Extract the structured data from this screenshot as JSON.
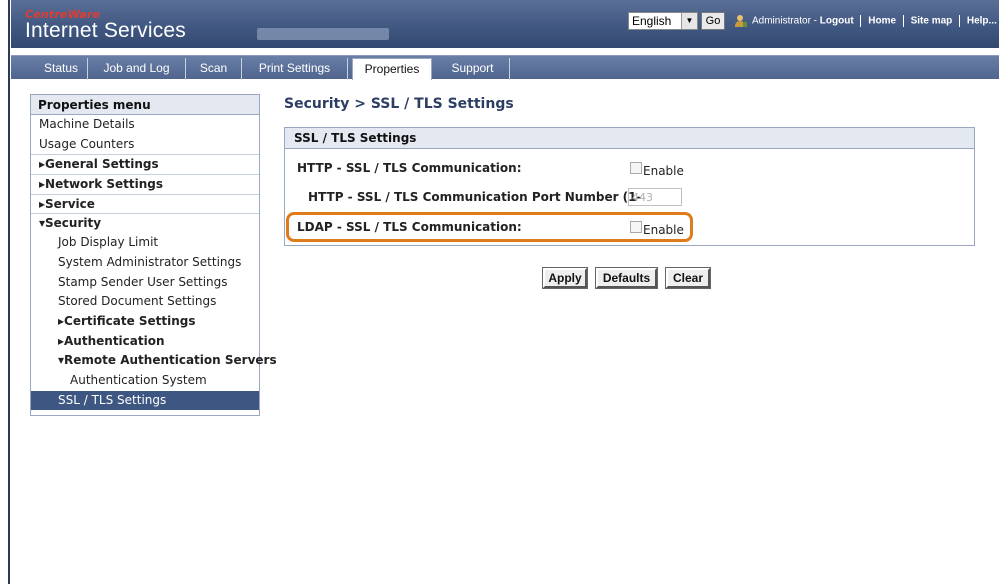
{
  "header": {
    "brand_small": "CentreWare",
    "brand_big": "Internet Services",
    "language": "English",
    "go_label": "Go",
    "user_text": "Administrator - ",
    "logout": "Logout",
    "home": "Home",
    "site_map": "Site map",
    "help": "Help..."
  },
  "nav": {
    "tabs": [
      "Status",
      "Job and Log",
      "Scan",
      "Print Settings",
      "Properties",
      "Support"
    ],
    "active": "Properties"
  },
  "sidebar": {
    "title": "Properties menu",
    "items": [
      "Machine Details",
      "Usage Counters",
      "▸General Settings",
      "▸Network Settings",
      "▸Service",
      "▾Security",
      "Job Display Limit",
      "System Administrator Settings",
      "Stamp Sender User Settings",
      "Stored Document Settings",
      "▸Certificate Settings",
      "▸Authentication",
      "▾Remote Authentication Servers",
      "Authentication System",
      "SSL / TLS Settings"
    ]
  },
  "main": {
    "breadcrumb": "Security > SSL / TLS Settings",
    "panel_title": "SSL / TLS Settings",
    "http_label": "HTTP - SSL / TLS Communication:",
    "http_enable": "Enable",
    "port_label": "HTTP - SSL / TLS Communication Port Number (1-",
    "port_value": "443",
    "ldap_label": "LDAP - SSL / TLS Communication:",
    "ldap_enable": "Enable"
  },
  "buttons": {
    "apply": "Apply",
    "defaults": "Defaults",
    "clear": "Clear"
  },
  "colors": {
    "header": "#3f5680",
    "highlight": "#e07b1a",
    "active_item": "#3e5782"
  }
}
